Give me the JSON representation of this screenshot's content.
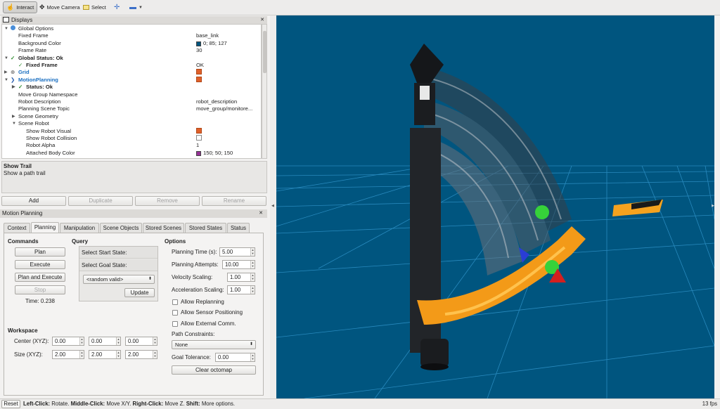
{
  "toolbar": {
    "interact": "Interact",
    "move_camera": "Move Camera",
    "select": "Select"
  },
  "displays": {
    "title": "Displays",
    "rows": [
      {
        "label": "Global Options"
      },
      {
        "label": "Fixed Frame",
        "value": "base_link"
      },
      {
        "label": "Background Color",
        "value": "0; 85; 127"
      },
      {
        "label": "Frame Rate",
        "value": "30"
      },
      {
        "label": "Global Status: Ok"
      },
      {
        "label": "Fixed Frame",
        "value": "OK"
      },
      {
        "label": "Grid"
      },
      {
        "label": "MotionPlanning"
      },
      {
        "label": "Status: Ok"
      },
      {
        "label": "Move Group Namespace",
        "value": ""
      },
      {
        "label": "Robot Description",
        "value": "robot_description"
      },
      {
        "label": "Planning Scene Topic",
        "value": "move_group/monitore..."
      },
      {
        "label": "Scene Geometry"
      },
      {
        "label": "Scene Robot"
      },
      {
        "label": "Show Robot Visual"
      },
      {
        "label": "Show Robot Collision"
      },
      {
        "label": "Robot Alpha",
        "value": "1"
      },
      {
        "label": "Attached Body Color",
        "value": "150; 50; 150"
      }
    ],
    "colors": {
      "background": "#00557f",
      "attached_body": "#963296"
    }
  },
  "help": {
    "title": "Show Trail",
    "description": "Show a path trail"
  },
  "display_buttons": {
    "add": "Add",
    "duplicate": "Duplicate",
    "remove": "Remove",
    "rename": "Rename"
  },
  "motion_planning": {
    "title": "Motion Planning",
    "tabs": [
      "Context",
      "Planning",
      "Manipulation",
      "Scene Objects",
      "Stored Scenes",
      "Stored States",
      "Status"
    ],
    "active_tab": "Planning",
    "commands": {
      "heading": "Commands",
      "plan": "Plan",
      "execute": "Execute",
      "plan_and_execute": "Plan and Execute",
      "stop": "Stop",
      "time": "Time: 0.238"
    },
    "query": {
      "heading": "Query",
      "start_state": "Select Start State:",
      "goal_state": "Select Goal State:",
      "goal_value": "<random valid>",
      "update": "Update"
    },
    "options": {
      "heading": "Options",
      "planning_time_label": "Planning Time (s):",
      "planning_time": "5.00",
      "planning_attempts_label": "Planning Attempts:",
      "planning_attempts": "10.00",
      "velocity_scaling_label": "Velocity Scaling:",
      "velocity_scaling": "1.00",
      "acceleration_scaling_label": "Acceleration Scaling:",
      "acceleration_scaling": "1.00",
      "allow_replanning": "Allow Replanning",
      "allow_sensor_positioning": "Allow Sensor Positioning",
      "allow_external_comm": "Allow External Comm.",
      "path_constraints_label": "Path Constraints:",
      "path_constraints": "None",
      "goal_tolerance_label": "Goal Tolerance:",
      "goal_tolerance": "0.00",
      "clear_octomap": "Clear octomap"
    },
    "workspace": {
      "heading": "Workspace",
      "center_label": "Center (XYZ):",
      "center": [
        "0.00",
        "0.00",
        "0.00"
      ],
      "size_label": "Size (XYZ):",
      "size": [
        "2.00",
        "2.00",
        "2.00"
      ]
    }
  },
  "statusbar": {
    "reset": "Reset",
    "left_click": "Left-Click:",
    "left_click_desc": "Rotate.",
    "middle_click": "Middle-Click:",
    "middle_click_desc": "Move X/Y.",
    "right_click": "Right-Click:",
    "right_click_desc": "Move Z.",
    "shift": "Shift:",
    "shift_desc": "More options.",
    "fps": "13 fps"
  }
}
